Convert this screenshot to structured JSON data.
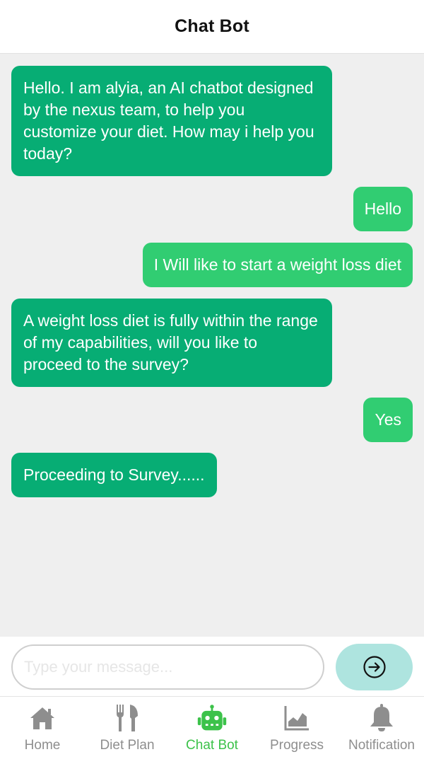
{
  "header": {
    "title": "Chat Bot"
  },
  "messages": [
    {
      "sender": "bot",
      "text": "Hello. I am alyia, an AI chatbot designed by the nexus team, to help you customize your diet. How may i help you today?"
    },
    {
      "sender": "user",
      "text": "Hello"
    },
    {
      "sender": "user",
      "text": "I Will like to start a weight loss diet"
    },
    {
      "sender": "bot",
      "text": "A weight loss diet is fully within the range of my capabilities, will you like to proceed to the survey?"
    },
    {
      "sender": "user",
      "text": "Yes"
    },
    {
      "sender": "bot",
      "text": "Proceeding to Survey......"
    }
  ],
  "composer": {
    "placeholder": "Type your message...",
    "value": "",
    "send_icon": "arrow-right-circle-icon"
  },
  "tabs": [
    {
      "label": "Home",
      "icon": "home-icon",
      "active": false
    },
    {
      "label": "Diet Plan",
      "icon": "fork-knife-icon",
      "active": false
    },
    {
      "label": "Chat Bot",
      "icon": "robot-icon",
      "active": true
    },
    {
      "label": "Progress",
      "icon": "area-chart-icon",
      "active": false
    },
    {
      "label": "Notification",
      "icon": "bell-icon",
      "active": false
    }
  ],
  "colors": {
    "bot_bubble": "#07ad74",
    "user_bubble": "#31cd72",
    "send_button": "#aee4df",
    "active_tab": "#3cc24a",
    "inactive_tab": "#8e8e8e"
  }
}
